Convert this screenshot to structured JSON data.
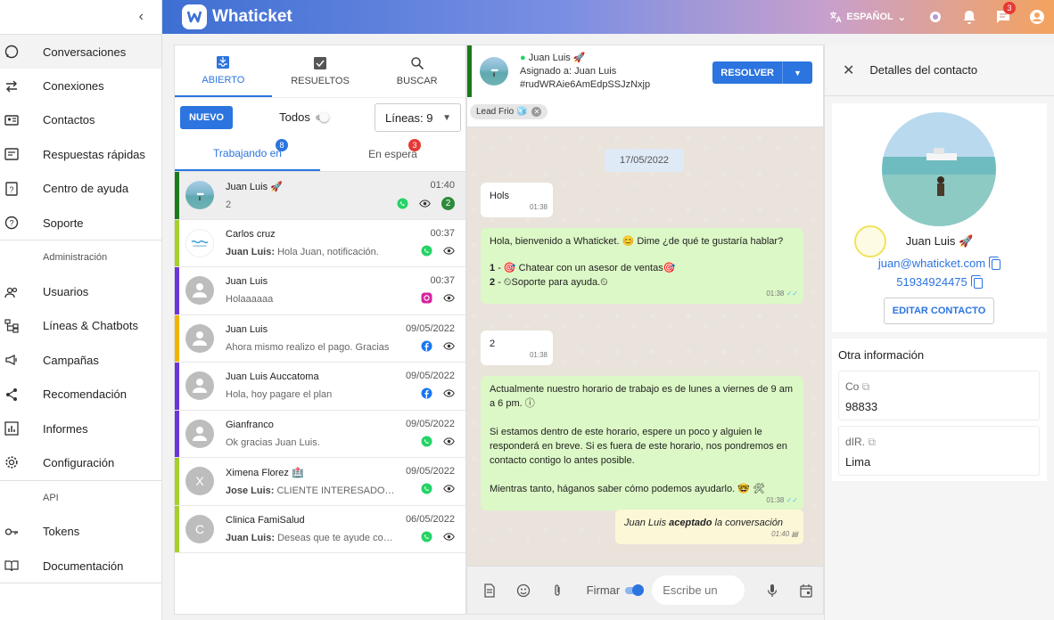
{
  "sidebar": {
    "items": [
      {
        "label": "Conversaciones",
        "icon": "whatsapp-icon"
      },
      {
        "label": "Conexiones",
        "icon": "swap-icon"
      },
      {
        "label": "Contactos",
        "icon": "contact-card-icon"
      },
      {
        "label": "Respuestas rápidas",
        "icon": "quick-reply-icon"
      },
      {
        "label": "Centro de ayuda",
        "icon": "help-icon"
      },
      {
        "label": "Soporte",
        "icon": "support-icon"
      }
    ],
    "admin_label": "Administración",
    "admin_items": [
      {
        "label": "Usuarios",
        "icon": "users-icon"
      },
      {
        "label": "Líneas & Chatbots",
        "icon": "hierarchy-icon"
      },
      {
        "label": "Campañas",
        "icon": "megaphone-icon"
      },
      {
        "label": "Recomendación",
        "icon": "share-icon"
      },
      {
        "label": "Informes",
        "icon": "chart-icon"
      },
      {
        "label": "Configuración",
        "icon": "gear-icon"
      }
    ],
    "api_label": "API",
    "api_items": [
      {
        "label": "Tokens",
        "icon": "key-icon"
      },
      {
        "label": "Documentación",
        "icon": "book-icon"
      }
    ]
  },
  "header": {
    "brand": "Whaticket",
    "language": "ESPAÑOL",
    "chat_badge": "3"
  },
  "tickets": {
    "tabs": [
      "ABIERTO",
      "RESUELTOS",
      "BUSCAR"
    ],
    "new_button": "NUEVO",
    "todos_label": "Todos",
    "lines_select": "Líneas: 9",
    "subtabs": [
      {
        "label": "Trabajando en",
        "badge": "8"
      },
      {
        "label": "En espera",
        "badge": "3"
      }
    ],
    "items": [
      {
        "name": "Juan Luis 🚀",
        "time": "01:40",
        "msg": "2",
        "sender": "",
        "channel": "whatsapp",
        "count": "2",
        "bar": "#1b7a1b",
        "avatar": "beach",
        "selected": true
      },
      {
        "name": "Carlos cruz",
        "time": "00:37",
        "sender": "Juan Luis:",
        "msg": "Hola Juan, notificación.",
        "channel": "whatsapp",
        "bar": "#a6cf2b",
        "avatar": "logo"
      },
      {
        "name": "Juan Luis",
        "time": "00:37",
        "sender": "",
        "msg": "Holaaaaaa",
        "channel": "instagram",
        "bar": "#6a37d6",
        "avatar": "person"
      },
      {
        "name": "Juan Luis",
        "time": "09/05/2022",
        "sender": "",
        "msg": "Ahora mismo realizo el pago. Gracias",
        "channel": "facebook",
        "bar": "#f0b400",
        "avatar": "person"
      },
      {
        "name": "Juan Luis Auccatoma",
        "time": "09/05/2022",
        "sender": "",
        "msg": "Hola, hoy pagare el plan",
        "channel": "facebook",
        "bar": "#6a37d6",
        "avatar": "person"
      },
      {
        "name": "Gianfranco",
        "time": "09/05/2022",
        "sender": "",
        "msg": "Ok gracias Juan Luis.",
        "channel": "whatsapp",
        "bar": "#6a37d6",
        "avatar": "person"
      },
      {
        "name": "Ximena Florez 🏥",
        "time": "09/05/2022",
        "sender": "Jose Luis:",
        "msg": "CLIENTE INTERESADO, P...",
        "channel": "whatsapp",
        "bar": "#a6cf2b",
        "avatar": "X"
      },
      {
        "name": "Clinica FamiSalud",
        "time": "06/05/2022",
        "sender": "Juan Luis:",
        "msg": "Deseas que te ayude con ...",
        "channel": "whatsapp",
        "bar": "#a6cf2b",
        "avatar": "C"
      }
    ]
  },
  "chat": {
    "contact": "Juan Luis 🚀",
    "assigned": "Asignado a: Juan Luis",
    "ticket_id": "#rudWRAie6AmEdpSSJzNxjp",
    "resolve_button": "RESOLVER",
    "tag": "Lead Frio 🧊",
    "date": "17/05/2022",
    "messages": {
      "m1": {
        "text": "Hols",
        "time": "01:38"
      },
      "m2": {
        "line1": "Hola, bienvenido a Whaticket. 😊 Dime ¿de qué te gustaría hablar?",
        "opt1_num": "1",
        "opt1": "- 🎯 Chatear con un asesor de ventas🎯",
        "opt2_num": "2",
        "opt2": "- ⏲Soporte para ayuda.⏲",
        "time": "01:38"
      },
      "m3": {
        "text": "2",
        "time": "01:38"
      },
      "m4": {
        "p1": "Actualmente nuestro horario de trabajo es de lunes a viernes de 9 am a 6 pm. ⓘ",
        "p2": "Si estamos dentro de este horario, espere un poco y alguien le responderá en breve. Si es fuera de este horario, nos pondremos en contacto contigo lo antes posible.",
        "p3": "Mientras tanto, háganos saber cómo podemos ayudarlo. 🤓 🛠",
        "time": "01:38"
      },
      "m5": {
        "pre": "Juan Luis ",
        "bold": "aceptado",
        "post": " la conversación",
        "time": "01:40"
      }
    },
    "signature_label": "Firmar",
    "compose_placeholder": "Escribe un"
  },
  "details": {
    "title": "Detalles del contacto",
    "name": "Juan Luis 🚀",
    "email": "juan@whaticket.com",
    "phone": "51934924475",
    "edit_button": "EDITAR CONTACTO",
    "other_title": "Otra información",
    "fields": [
      {
        "key": "Co",
        "value": "98833"
      },
      {
        "key": "dIR.",
        "value": "Lima"
      }
    ]
  },
  "colors": {
    "primary": "#2c74e0",
    "sent_bubble": "#dcf8c6",
    "chat_bg": "#e9e3db"
  }
}
